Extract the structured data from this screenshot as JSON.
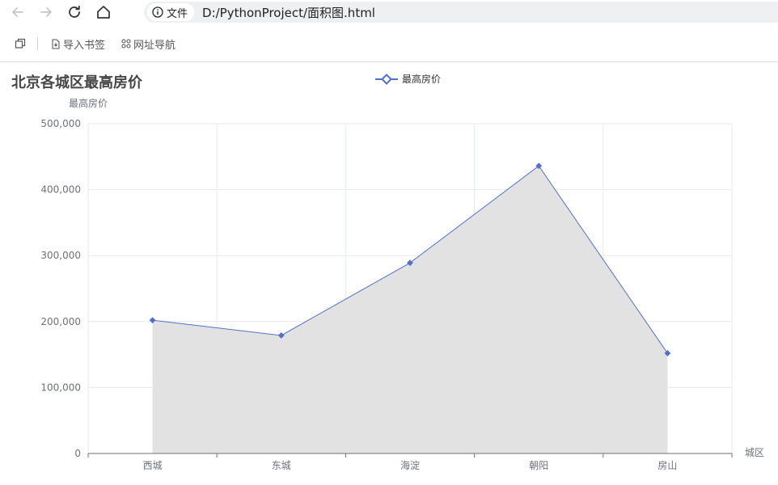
{
  "browser": {
    "file_label": "文件",
    "url": "D:/PythonProject/面积图.html",
    "bookmarks": [
      "导入书签",
      "网址导航"
    ]
  },
  "chart_data": {
    "type": "area",
    "title": "北京各城区最高房价",
    "ylabel": "最高房价",
    "xlabel": "城区",
    "categories": [
      "西城",
      "东城",
      "海淀",
      "朝阳",
      "房山"
    ],
    "series": [
      {
        "name": "最高房价",
        "values": [
          202000,
          179000,
          289000,
          436000,
          152000
        ],
        "color": "#5470c6"
      }
    ],
    "area_color": "#e2e2e2",
    "ylim": [
      0,
      500000
    ],
    "yticks": [
      "0",
      "100,000",
      "200,000",
      "300,000",
      "400,000",
      "500,000"
    ],
    "legend_position": "top-center",
    "grid": true
  }
}
